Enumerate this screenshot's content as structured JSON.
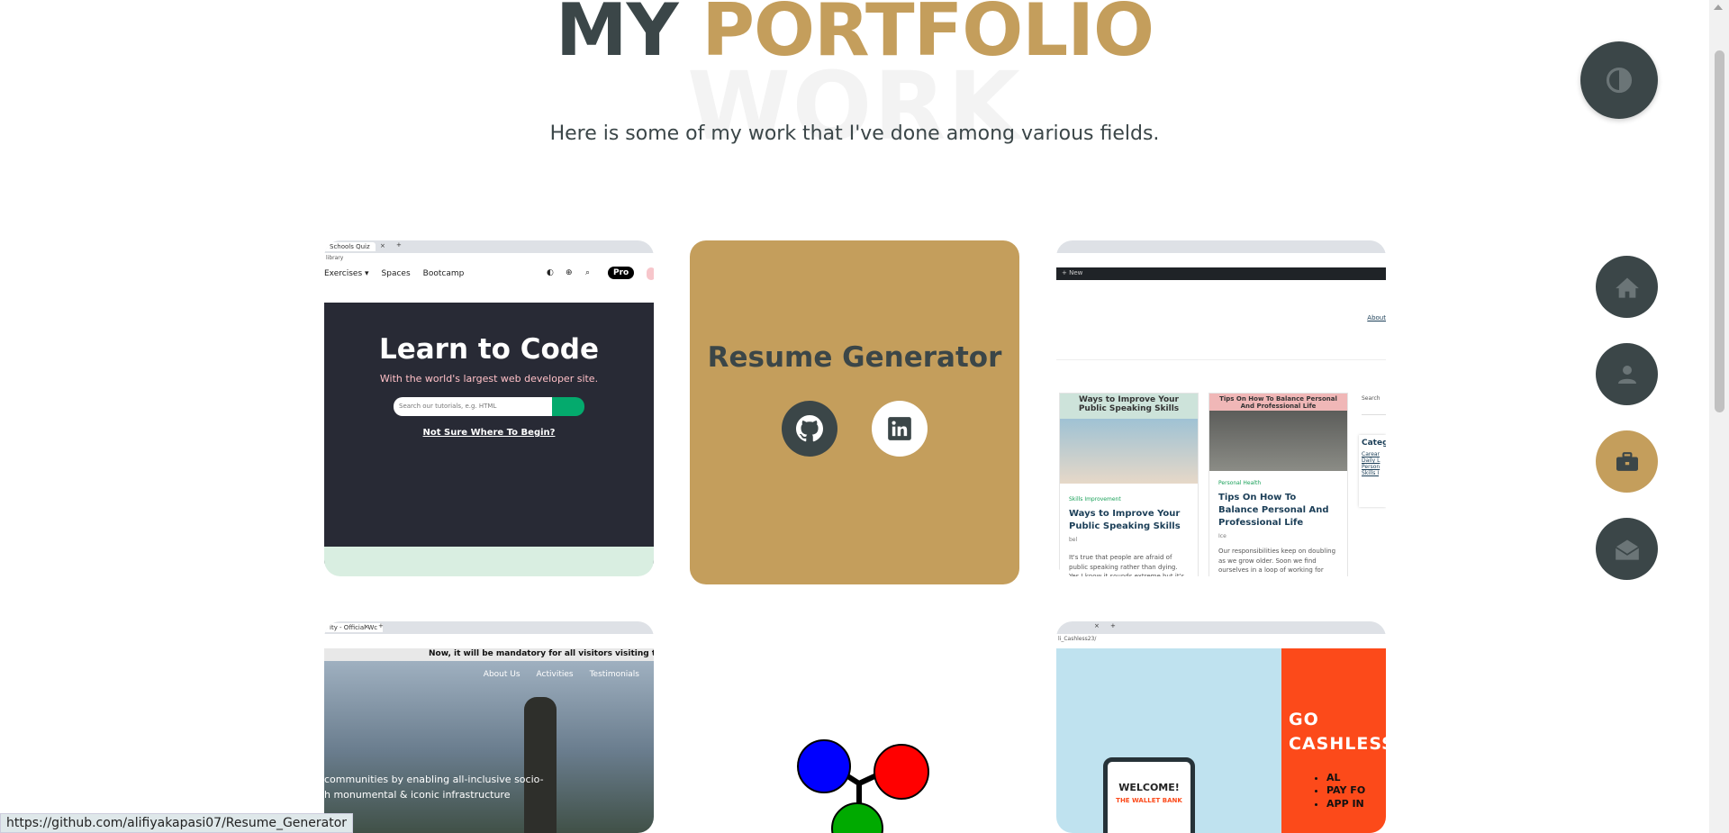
{
  "heading": {
    "my": "MY",
    "portfolio": "PORTFOLIO",
    "bg_word": "WORK"
  },
  "subtitle": "Here is some of my work that I've done among various fields.",
  "cards": {
    "w3": {
      "tab_label": "Schools Quiz",
      "address": "library",
      "nav": [
        "Exercises ▾",
        "Spaces",
        "Bootcamp"
      ],
      "pro": "Pro",
      "hero_title": "Learn to Code",
      "hero_sub": "With the world's largest web developer site.",
      "search_placeholder": "Search our tutorials, e.g. HTML",
      "link": "Not Sure Where To Begin?"
    },
    "resume": {
      "title": "Resume Generator",
      "github": "github-icon",
      "linkedin": "linkedin-icon"
    },
    "blog": {
      "tab_label": "New",
      "link": "About",
      "search": "Search",
      "categories": "Categ",
      "cat_links": [
        "Carear",
        "Daily L",
        "Person",
        "Skills I"
      ],
      "posts": [
        {
          "header": "Ways to Improve Your Public Speaking Skills",
          "category": "Skills Improvement",
          "title": "Ways to Improve Your Public Speaking Skills",
          "meta": "bel",
          "excerpt": "It's true that people are afraid of public speaking rather than dying. Yes I know it sounds extreme but it's true and makes sense"
        },
        {
          "header": "Tips On How To Balance Personal And Professional Life",
          "category": "Personal Health",
          "title": "Tips On How To Balance Personal And Professional Life",
          "meta": "Ice",
          "excerpt": "Our responsibilities keep on doubling as we grow older. Soon we find ourselves in a loop of working for hours and have no personal time ..."
        }
      ]
    },
    "statue": {
      "tab_label": "ity - Official Wc",
      "banner": "Now, it will be mandatory for all visitors visiting the St",
      "nav": [
        "About Us",
        "Activities",
        "Testimonials"
      ],
      "text_line1": "communities by enabling all-inclusive socio-",
      "text_line2": "h monumental & iconic infrastructure"
    },
    "wallet": {
      "address": "li_Cashless23/",
      "go": "GO",
      "cashless": "CASHLESS",
      "bullets": [
        "AL",
        "PAY FO",
        "APP IN"
      ],
      "welcome": "WELCOME!",
      "bank": "THE WALLET BANK"
    }
  },
  "status_url": "https://github.com/alifiyakapasi07/Resume_Generator",
  "colors": {
    "accent": "#c49e5c",
    "dark": "#3b4648"
  }
}
